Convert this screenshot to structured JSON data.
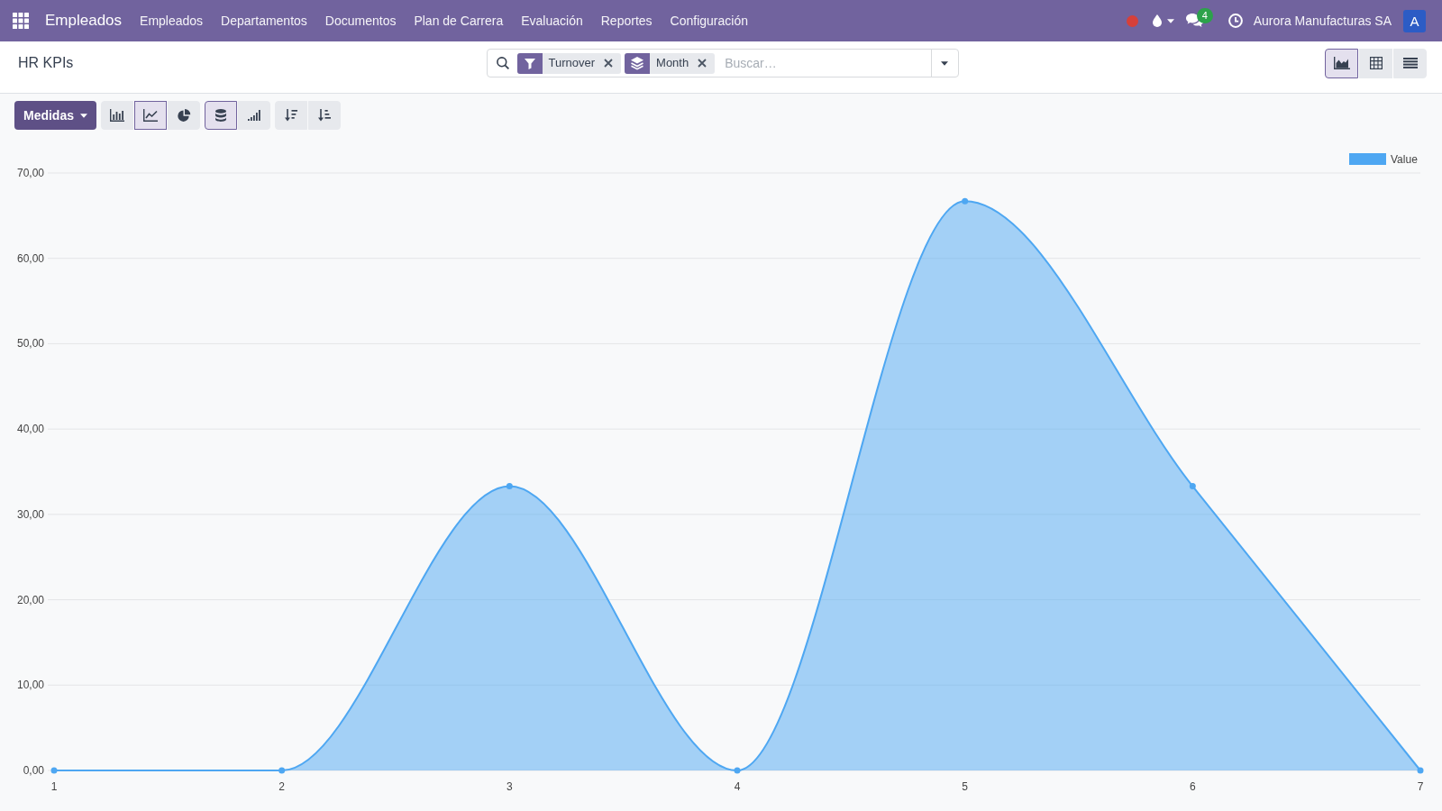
{
  "navbar": {
    "app_name": "Empleados",
    "menu": [
      "Empleados",
      "Departamentos",
      "Documentos",
      "Plan de Carrera",
      "Evaluación",
      "Reportes",
      "Configuración"
    ],
    "systray": {
      "messages_count": "4",
      "company": "Aurora Manufacturas SA",
      "avatar_initial": "A"
    }
  },
  "control_panel": {
    "title": "HR KPIs",
    "search": {
      "facets": [
        {
          "kind": "filter",
          "label": "Turnover"
        },
        {
          "kind": "groupby",
          "label": "Month"
        }
      ],
      "placeholder": "Buscar…"
    },
    "views": [
      {
        "kind": "graph",
        "selected": true
      },
      {
        "kind": "pivot",
        "selected": false
      },
      {
        "kind": "list",
        "selected": false
      }
    ]
  },
  "toolbar": {
    "measures_button": "Medidas",
    "chart_modes": [
      {
        "kind": "bar",
        "selected": false
      },
      {
        "kind": "line",
        "selected": true
      },
      {
        "kind": "pie",
        "selected": false
      }
    ],
    "options": [
      {
        "kind": "stacked",
        "selected": true
      },
      {
        "kind": "cumulative",
        "selected": false
      }
    ],
    "sort": [
      {
        "kind": "descending",
        "selected": false
      },
      {
        "kind": "ascending",
        "selected": false
      }
    ]
  },
  "chart": {
    "chart_data": {
      "type": "area",
      "categories": [
        "1",
        "2",
        "3",
        "4",
        "5",
        "6",
        "7"
      ],
      "series": [
        {
          "name": "Value",
          "color": "#4ea7f2",
          "values": [
            0,
            0,
            33.3,
            0,
            66.7,
            33.3,
            0
          ]
        }
      ],
      "ylim": [
        0,
        70
      ],
      "yticks": [
        {
          "value": 0,
          "label": "0,00"
        },
        {
          "value": 10,
          "label": "10,00"
        },
        {
          "value": 20,
          "label": "20,00"
        },
        {
          "value": 30,
          "label": "30,00"
        },
        {
          "value": 40,
          "label": "40,00"
        },
        {
          "value": 50,
          "label": "50,00"
        },
        {
          "value": 60,
          "label": "60,00"
        },
        {
          "value": 70,
          "label": "70,00"
        }
      ],
      "grid": true
    }
  }
}
